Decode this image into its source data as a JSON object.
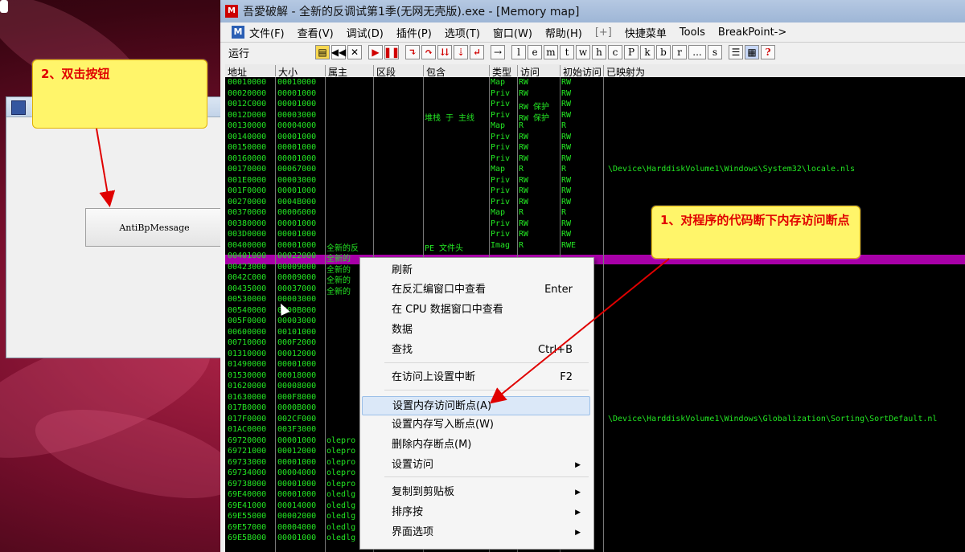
{
  "olly": {
    "title": "吾愛破解 - 全新的反调试第1季(无网无壳版).exe - [Memory map]",
    "menu": [
      "文件(F)",
      "查看(V)",
      "调试(D)",
      "插件(P)",
      "选项(T)",
      "窗口(W)",
      "帮助(H)",
      "[+]",
      "快捷菜单",
      "Tools",
      "BreakPoint->"
    ],
    "status": "运行",
    "toolbar_letters": [
      "l",
      "e",
      "m",
      "t",
      "w",
      "h",
      "c",
      "P",
      "k",
      "b",
      "r",
      "...",
      "s"
    ],
    "columns": [
      "地址",
      "大小",
      "属主",
      "区段",
      "包含",
      "类型",
      "访问",
      "初始访问",
      "已映射为"
    ]
  },
  "memory_rows": [
    [
      "00010000",
      "00010000",
      "",
      "",
      "",
      "Map",
      "RW",
      "RW",
      ""
    ],
    [
      "00020000",
      "00001000",
      "",
      "",
      "",
      "Priv",
      "RW",
      "RW",
      ""
    ],
    [
      "0012C000",
      "00001000",
      "",
      "",
      "",
      "Priv",
      "RW 保护",
      "RW",
      ""
    ],
    [
      "0012D000",
      "00003000",
      "",
      "",
      "堆栈 于 主线",
      "Priv",
      "RW 保护",
      "RW",
      ""
    ],
    [
      "00130000",
      "00004000",
      "",
      "",
      "",
      "Map",
      "R",
      "R",
      ""
    ],
    [
      "00140000",
      "00001000",
      "",
      "",
      "",
      "Priv",
      "RW",
      "RW",
      ""
    ],
    [
      "00150000",
      "00001000",
      "",
      "",
      "",
      "Priv",
      "RW",
      "RW",
      ""
    ],
    [
      "00160000",
      "00001000",
      "",
      "",
      "",
      "Priv",
      "RW",
      "RW",
      ""
    ],
    [
      "00170000",
      "00067000",
      "",
      "",
      "",
      "Map",
      "R",
      "R",
      "\\Device\\HarddiskVolume1\\Windows\\System32\\locale.nls"
    ],
    [
      "001E0000",
      "00003000",
      "",
      "",
      "",
      "Priv",
      "RW",
      "RW",
      ""
    ],
    [
      "001F0000",
      "00001000",
      "",
      "",
      "",
      "Priv",
      "RW",
      "RW",
      ""
    ],
    [
      "00270000",
      "0004B000",
      "",
      "",
      "",
      "Priv",
      "RW",
      "RW",
      ""
    ],
    [
      "00370000",
      "00006000",
      "",
      "",
      "",
      "Map",
      "R",
      "R",
      ""
    ],
    [
      "00380000",
      "00001000",
      "",
      "",
      "",
      "Priv",
      "RW",
      "RW",
      ""
    ],
    [
      "003D0000",
      "00001000",
      "",
      "",
      "",
      "Priv",
      "RW",
      "RW",
      ""
    ],
    [
      "00400000",
      "00001000",
      "全新的反",
      "",
      "PE 文件头",
      "Imag",
      "R",
      "RWE",
      ""
    ],
    [
      "00401000",
      "00022000",
      "全新的",
      "",
      "",
      "",
      "",
      "",
      ""
    ],
    [
      "00423000",
      "00009000",
      "全新的",
      "",
      "",
      "",
      "",
      "",
      ""
    ],
    [
      "0042C000",
      "00009000",
      "全新的",
      "",
      "",
      "",
      "",
      "",
      ""
    ],
    [
      "00435000",
      "00037000",
      "全新的",
      "",
      "",
      "",
      "",
      "",
      ""
    ],
    [
      "00530000",
      "00003000",
      "",
      "",
      "",
      "",
      "",
      "",
      ""
    ],
    [
      "00540000",
      "0000B000",
      "",
      "",
      "",
      "",
      "",
      "",
      ""
    ],
    [
      "005F0000",
      "00003000",
      "",
      "",
      "",
      "",
      "",
      "",
      ""
    ],
    [
      "00600000",
      "00101000",
      "",
      "",
      "",
      "",
      "",
      "",
      ""
    ],
    [
      "00710000",
      "000F2000",
      "",
      "",
      "",
      "",
      "",
      "",
      ""
    ],
    [
      "01310000",
      "00012000",
      "",
      "",
      "",
      "",
      "",
      "",
      ""
    ],
    [
      "01490000",
      "00001000",
      "",
      "",
      "",
      "",
      "",
      "",
      ""
    ],
    [
      "01530000",
      "00018000",
      "",
      "",
      "",
      "",
      "",
      "",
      ""
    ],
    [
      "01620000",
      "00008000",
      "",
      "",
      "",
      "",
      "",
      "",
      ""
    ],
    [
      "01630000",
      "000F8000",
      "",
      "",
      "",
      "",
      "",
      "",
      ""
    ],
    [
      "017B0000",
      "0000B000",
      "",
      "",
      "",
      "",
      "",
      "",
      ""
    ],
    [
      "017F0000",
      "002CF000",
      "",
      "",
      "",
      "",
      "",
      "",
      "\\Device\\HarddiskVolume1\\Windows\\Globalization\\Sorting\\SortDefault.nl"
    ],
    [
      "01AC0000",
      "003F3000",
      "",
      "",
      "",
      "",
      "",
      "",
      ""
    ],
    [
      "69720000",
      "00001000",
      "olepro",
      "",
      "",
      "",
      "",
      "",
      ""
    ],
    [
      "69721000",
      "00012000",
      "olepro",
      "",
      "",
      "",
      "",
      "",
      ""
    ],
    [
      "69733000",
      "00001000",
      "olepro",
      "",
      "",
      "",
      "",
      "",
      ""
    ],
    [
      "69734000",
      "00004000",
      "olepro",
      "",
      "",
      "",
      "",
      "",
      ""
    ],
    [
      "69738000",
      "00001000",
      "olepro",
      "",
      "",
      "",
      "",
      "",
      ""
    ],
    [
      "69E40000",
      "00001000",
      "oledlg",
      "",
      "",
      "",
      "",
      "",
      ""
    ],
    [
      "69E41000",
      "00014000",
      "oledlg",
      "",
      "",
      "",
      "",
      "",
      ""
    ],
    [
      "69E55000",
      "00002000",
      "oledlg",
      "",
      "",
      "",
      "",
      "",
      ""
    ],
    [
      "69E57000",
      "00004000",
      "oledlg",
      "",
      "",
      "",
      "",
      "",
      ""
    ],
    [
      "69E5B000",
      "00001000",
      "oledlg",
      "",
      "",
      "",
      "",
      "",
      ""
    ]
  ],
  "context_menu": [
    {
      "label": "刷新",
      "shortcut": "",
      "arrow": false
    },
    {
      "label": "在反汇编窗口中查看",
      "shortcut": "Enter",
      "arrow": false
    },
    {
      "label": "在 CPU 数据窗口中查看",
      "shortcut": "",
      "arrow": false
    },
    {
      "label": "数据",
      "shortcut": "",
      "arrow": false
    },
    {
      "label": "查找",
      "shortcut": "Ctrl+B",
      "arrow": false
    },
    {
      "label": "在访问上设置中断",
      "shortcut": "F2",
      "arrow": false
    },
    {
      "label": "设置内存访问断点(A)",
      "shortcut": "",
      "arrow": false
    },
    {
      "label": "设置内存写入断点(W)",
      "shortcut": "",
      "arrow": false
    },
    {
      "label": "删除内存断点(M)",
      "shortcut": "",
      "arrow": false
    },
    {
      "label": "设置访问",
      "shortcut": "",
      "arrow": true
    },
    {
      "label": "复制到剪贴板",
      "shortcut": "",
      "arrow": true
    },
    {
      "label": "排序按",
      "shortcut": "",
      "arrow": true
    },
    {
      "label": "界面选项",
      "shortcut": "",
      "arrow": true
    }
  ],
  "dialog": {
    "button_label": "AntiBpMessage"
  },
  "annotations": {
    "step2": "2、双击按钮",
    "step1": "1、对程序的代码断下内存访问断点"
  },
  "colors": {
    "highlight": "#a800a8",
    "mem_text": "#23e623",
    "callout_text": "#e00000",
    "callout_bg": "#fff56a"
  }
}
